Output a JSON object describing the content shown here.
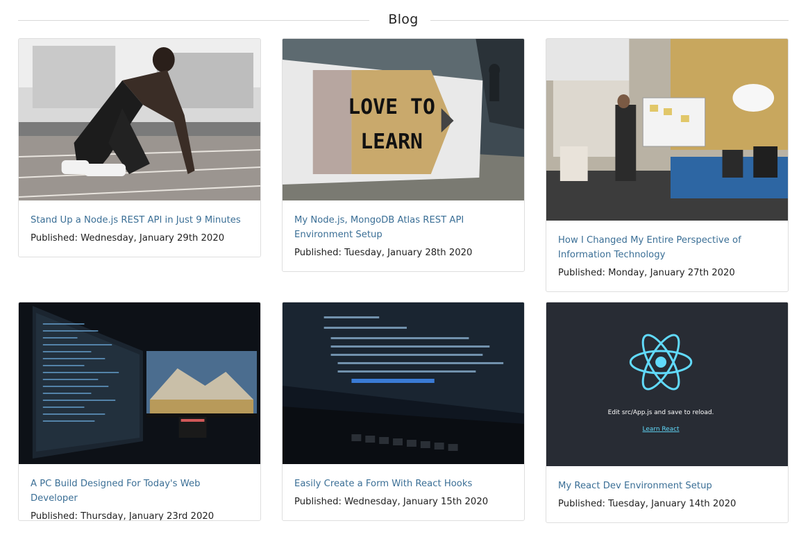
{
  "blog": {
    "title": "Blog"
  },
  "posts": [
    {
      "title": "Stand Up a Node.js REST API in Just 9 Minutes",
      "published": "Published: Wednesday, January 29th 2020",
      "image": "sprinter-starting-block-photo"
    },
    {
      "title": "My Node.js, MongoDB Atlas REST API Environment Setup",
      "published": "Published: Tuesday, January 28th 2020",
      "image": "love-to-learn-pencil-sign-photo",
      "image_text": [
        "LOVE TO",
        "LEARN"
      ]
    },
    {
      "title": "How I Changed My Entire Perspective of Information Technology",
      "published": "Published: Monday, January 27th 2020",
      "image": "office-team-whiteboard-photo"
    },
    {
      "title": "A PC Build Designed For Today's Web Developer",
      "published": "Published: Thursday, January 23rd 2020",
      "image": "dual-monitor-desk-photo"
    },
    {
      "title": "Easily Create a Form With React Hooks",
      "published": "Published: Wednesday, January 15th 2020",
      "image": "laptop-code-screen-photo"
    },
    {
      "title": "My React Dev Environment Setup",
      "published": "Published: Tuesday, January 14th 2020",
      "image": "react-app-screen",
      "image_text": [
        "Edit src/App.js and save to reload.",
        "Learn React"
      ]
    }
  ],
  "colors": {
    "link": "#3b6f96",
    "text": "#222222",
    "border": "#dedede",
    "react_bg": "#282c34",
    "react_logo": "#61dafb"
  }
}
